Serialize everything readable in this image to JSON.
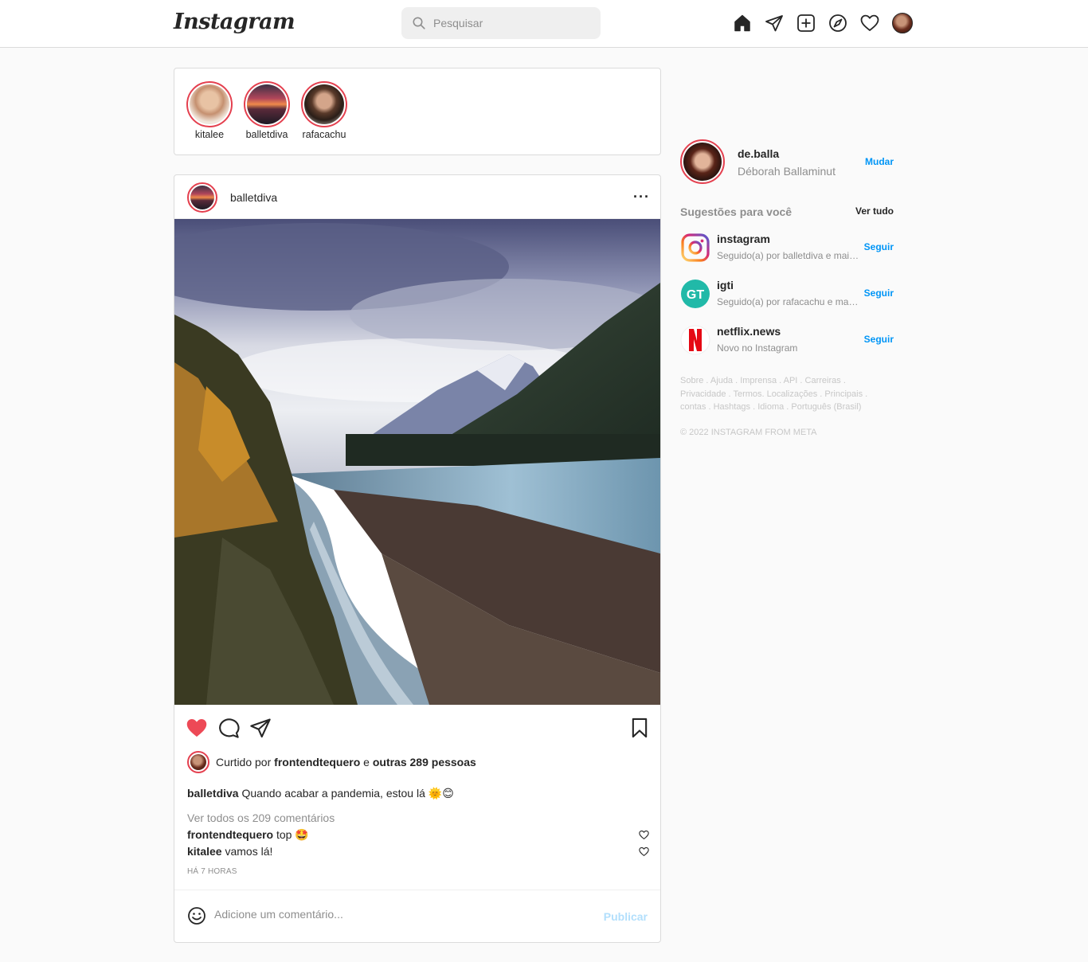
{
  "header": {
    "logo": "Instagram",
    "search_placeholder": "Pesquisar"
  },
  "stories": [
    {
      "name": "kitalee"
    },
    {
      "name": "balletdiva"
    },
    {
      "name": "rafacachu"
    }
  ],
  "post": {
    "username": "balletdiva",
    "more": "···",
    "liked_by_prefix": "Curtido por",
    "liked_by_user": "frontendtequero",
    "liked_by_conj": "e",
    "liked_by_others": "outras 289 pessoas",
    "caption_user": "balletdiva",
    "caption_text": "Quando acabar a pandemia, estou lá 🌞😊",
    "view_all": "Ver todos os 209 comentários",
    "comments": [
      {
        "user": "frontendtequero",
        "text": "top 🤩"
      },
      {
        "user": "kitalee",
        "text": "vamos lá!"
      }
    ],
    "time_ago": "HÁ 7 HORAS",
    "add_comment_placeholder": "Adicione um comentário...",
    "publish": "Publicar"
  },
  "sidebar": {
    "me": {
      "username": "de.balla",
      "full_name": "Déborah Ballaminut",
      "switch": "Mudar"
    },
    "suggestions_title": "Sugestões para você",
    "see_all": "Ver tudo",
    "suggestions": [
      {
        "username": "instagram",
        "subtitle": "Seguido(a) por balletdiva e mais...",
        "follow": "Seguir",
        "icon": "instagram-logo-icon"
      },
      {
        "username": "igti",
        "subtitle": "Seguido(a) por rafacachu e mais...",
        "follow": "Seguir",
        "icon": "igti-logo-icon"
      },
      {
        "username": "netflix.news",
        "subtitle": "Novo no Instagram",
        "follow": "Seguir",
        "icon": "netflix-logo-icon"
      }
    ],
    "footer": "Sobre . Ajuda . Imprensa . API . Carreiras . Privacidade . Termos. Localizações . Principais . contas . Hashtags . Idioma . Português (Brasil)",
    "copyright": "© 2022 INSTAGRAM FROM META"
  },
  "colors": {
    "accent_blue": "#0095f6",
    "story_ring": "#e4404f",
    "like_red": "#ed4956"
  }
}
